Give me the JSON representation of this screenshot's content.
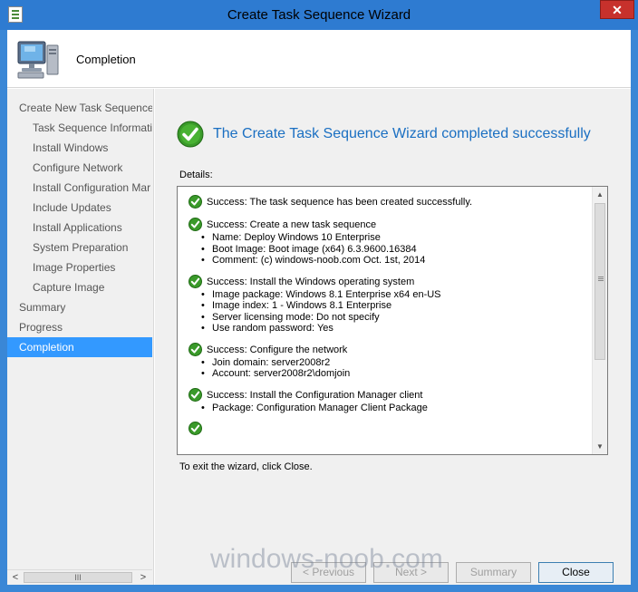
{
  "window": {
    "title": "Create Task Sequence Wizard",
    "close_glyph": "✕",
    "accent_color": "#2e7bd1"
  },
  "header": {
    "title": "Completion",
    "icon": "computer-icon"
  },
  "sidebar": {
    "items": [
      {
        "label": "Create New Task Sequence",
        "level": 0,
        "selected": false
      },
      {
        "label": "Task Sequence Informati",
        "level": 1,
        "selected": false
      },
      {
        "label": "Install Windows",
        "level": 1,
        "selected": false
      },
      {
        "label": "Configure Network",
        "level": 1,
        "selected": false
      },
      {
        "label": "Install Configuration Mar",
        "level": 1,
        "selected": false
      },
      {
        "label": "Include Updates",
        "level": 1,
        "selected": false
      },
      {
        "label": "Install Applications",
        "level": 1,
        "selected": false
      },
      {
        "label": "System Preparation",
        "level": 1,
        "selected": false
      },
      {
        "label": "Image Properties",
        "level": 1,
        "selected": false
      },
      {
        "label": "Capture Image",
        "level": 1,
        "selected": false
      },
      {
        "label": "Summary",
        "level": 0,
        "selected": false
      },
      {
        "label": "Progress",
        "level": 0,
        "selected": false
      },
      {
        "label": "Completion",
        "level": 0,
        "selected": true
      }
    ],
    "scroll_left": "<",
    "scroll_right": ">",
    "scroll_thumb": "III"
  },
  "main": {
    "heading": "The Create Task Sequence Wizard completed successfully",
    "details_label": "Details:",
    "steps": [
      {
        "head": "Success: The task sequence has been created successfully.",
        "bullets": []
      },
      {
        "head": "Success: Create a new task sequence",
        "bullets": [
          "Name: Deploy Windows 10 Enterprise",
          "Boot Image: Boot image (x64) 6.3.9600.16384",
          "Comment: (c) windows-noob.com Oct. 1st, 2014"
        ]
      },
      {
        "head": "Success: Install the Windows operating system",
        "bullets": [
          "Image package: Windows 8.1 Enterprise x64 en-US",
          "Image index: 1 - Windows 8.1 Enterprise",
          "Server licensing mode: Do not specify",
          "Use random password: Yes"
        ]
      },
      {
        "head": "Success: Configure the network",
        "bullets": [
          "Join domain: server2008r2",
          "Account: server2008r2\\domjoin"
        ]
      },
      {
        "head": "Success: Install the Configuration Manager client",
        "bullets": [
          "Package: Configuration Manager Client Package"
        ]
      },
      {
        "head": "",
        "bullets": []
      }
    ],
    "exit_note": "To exit the wizard, click Close.",
    "scroll_up": "▲",
    "scroll_down": "▼",
    "success_color": "#3a9a2a"
  },
  "buttons": {
    "previous": "< Previous",
    "next": "Next >",
    "summary": "Summary",
    "close": "Close"
  },
  "watermark": "windows-noob.com"
}
